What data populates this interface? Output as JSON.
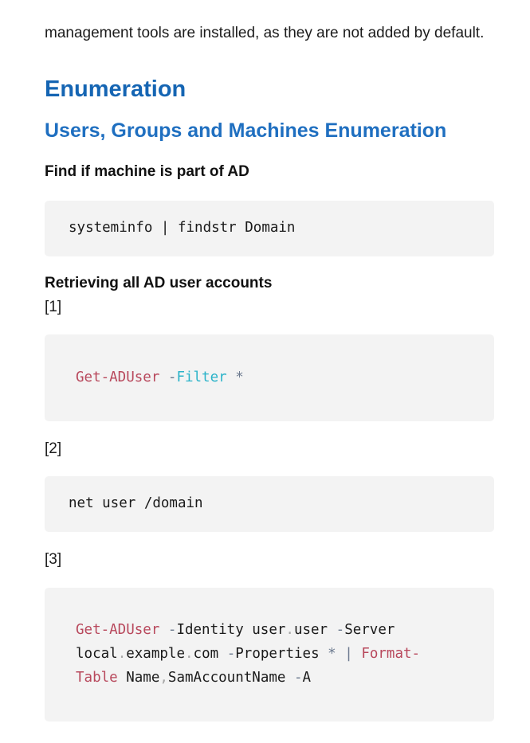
{
  "intro": {
    "text": "management tools are installed, as they are not added by default."
  },
  "section": {
    "title": "Enumeration",
    "subsection": "Users, Groups and Machines Enumeration"
  },
  "items": {
    "find_machine": {
      "heading": "Find if machine is part of AD",
      "code": "systeminfo | findstr Domain"
    },
    "retrieve_users": {
      "heading": "Retrieving all AD user accounts",
      "refs": [
        "[1]",
        "[2]",
        "[3]"
      ],
      "code1": {
        "cmd": "Get-ADUser",
        "dash": " -",
        "param": "Filter",
        "op": " *"
      },
      "code2": "net user /domain",
      "code3": {
        "l1_cmd": "Get-ADUser",
        "l1_d1": " -",
        "l1_t1": "Identity user",
        "l1_dot": ".",
        "l1_t2": "user ",
        "l1_d2": "-",
        "l1_t3": "Server",
        "l2_t1": "local",
        "l2_dot1": ".",
        "l2_t2": "example",
        "l2_dot2": ".",
        "l2_t3": "com ",
        "l2_d1": "-",
        "l2_t4": "Properties ",
        "l2_op": "* | ",
        "l2_cmd": "Format-",
        "l3_cmd": "Table",
        "l3_t1": " Name",
        "l3_comma": ",",
        "l3_t2": "SamAccountName ",
        "l3_d1": "-",
        "l3_t3": "A"
      }
    }
  }
}
